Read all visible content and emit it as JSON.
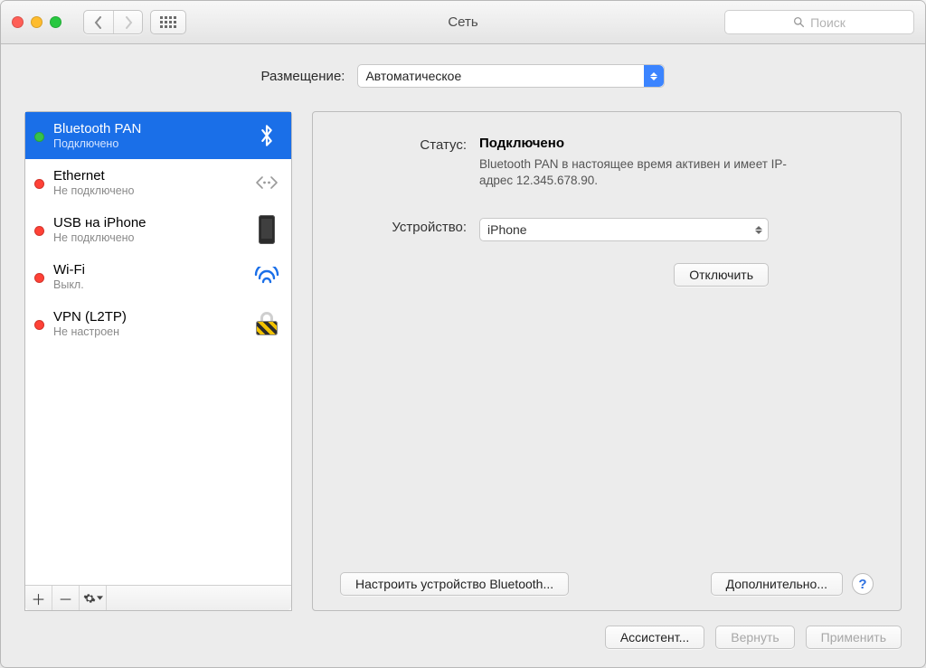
{
  "window": {
    "title": "Сеть"
  },
  "toolbar": {
    "search_placeholder": "Поиск"
  },
  "location": {
    "label": "Размещение:",
    "value": "Автоматическое"
  },
  "sidebar": {
    "items": [
      {
        "name": "Bluetooth PAN",
        "status": "Подключено",
        "dot": "green",
        "icon": "bluetooth",
        "selected": true
      },
      {
        "name": "Ethernet",
        "status": "Не подключено",
        "dot": "red",
        "icon": "ethernet",
        "selected": false
      },
      {
        "name": "USB на iPhone",
        "status": "Не подключено",
        "dot": "red",
        "icon": "iphone",
        "selected": false
      },
      {
        "name": "Wi-Fi",
        "status": "Выкл.",
        "dot": "red",
        "icon": "wifi",
        "selected": false
      },
      {
        "name": "VPN (L2TP)",
        "status": "Не настроен",
        "dot": "red",
        "icon": "lock",
        "selected": false
      }
    ]
  },
  "detail": {
    "status_label": "Статус:",
    "status_value": "Подключено",
    "status_desc": "Bluetooth PAN в настоящее время активен и имеет IP-адрес 12.345.678.90.",
    "device_label": "Устройство:",
    "device_value": "iPhone",
    "disconnect": "Отключить",
    "configure_bt": "Настроить устройство Bluetooth...",
    "advanced": "Дополнительно...",
    "help": "?"
  },
  "footer": {
    "assistant": "Ассистент...",
    "revert": "Вернуть",
    "apply": "Применить"
  }
}
